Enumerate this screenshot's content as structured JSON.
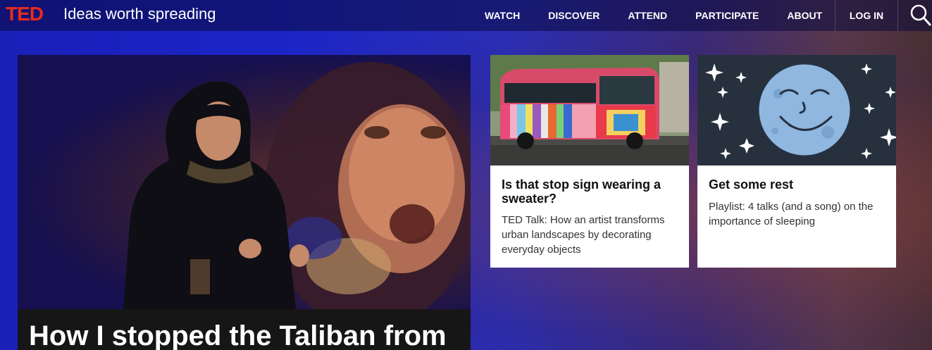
{
  "header": {
    "logo": "TED",
    "tagline": "Ideas worth spreading",
    "nav": [
      "WATCH",
      "DISCOVER",
      "ATTEND",
      "PARTICIPATE",
      "ABOUT"
    ],
    "login": "LOG IN",
    "search_icon": "search-icon"
  },
  "hero": {
    "title": "How I stopped the Taliban from"
  },
  "cards": [
    {
      "title": "Is that stop sign wearing a sweater?",
      "description": "TED Talk: How an artist transforms urban landscapes by decorating everyday objects"
    },
    {
      "title": "Get some rest",
      "description": "Playlist: 4 talks (and a song) on the importance of sleeping"
    }
  ],
  "colors": {
    "brand_red": "#e62b1e",
    "night_sky": "#27303d",
    "moon": "#8fb7e0"
  }
}
